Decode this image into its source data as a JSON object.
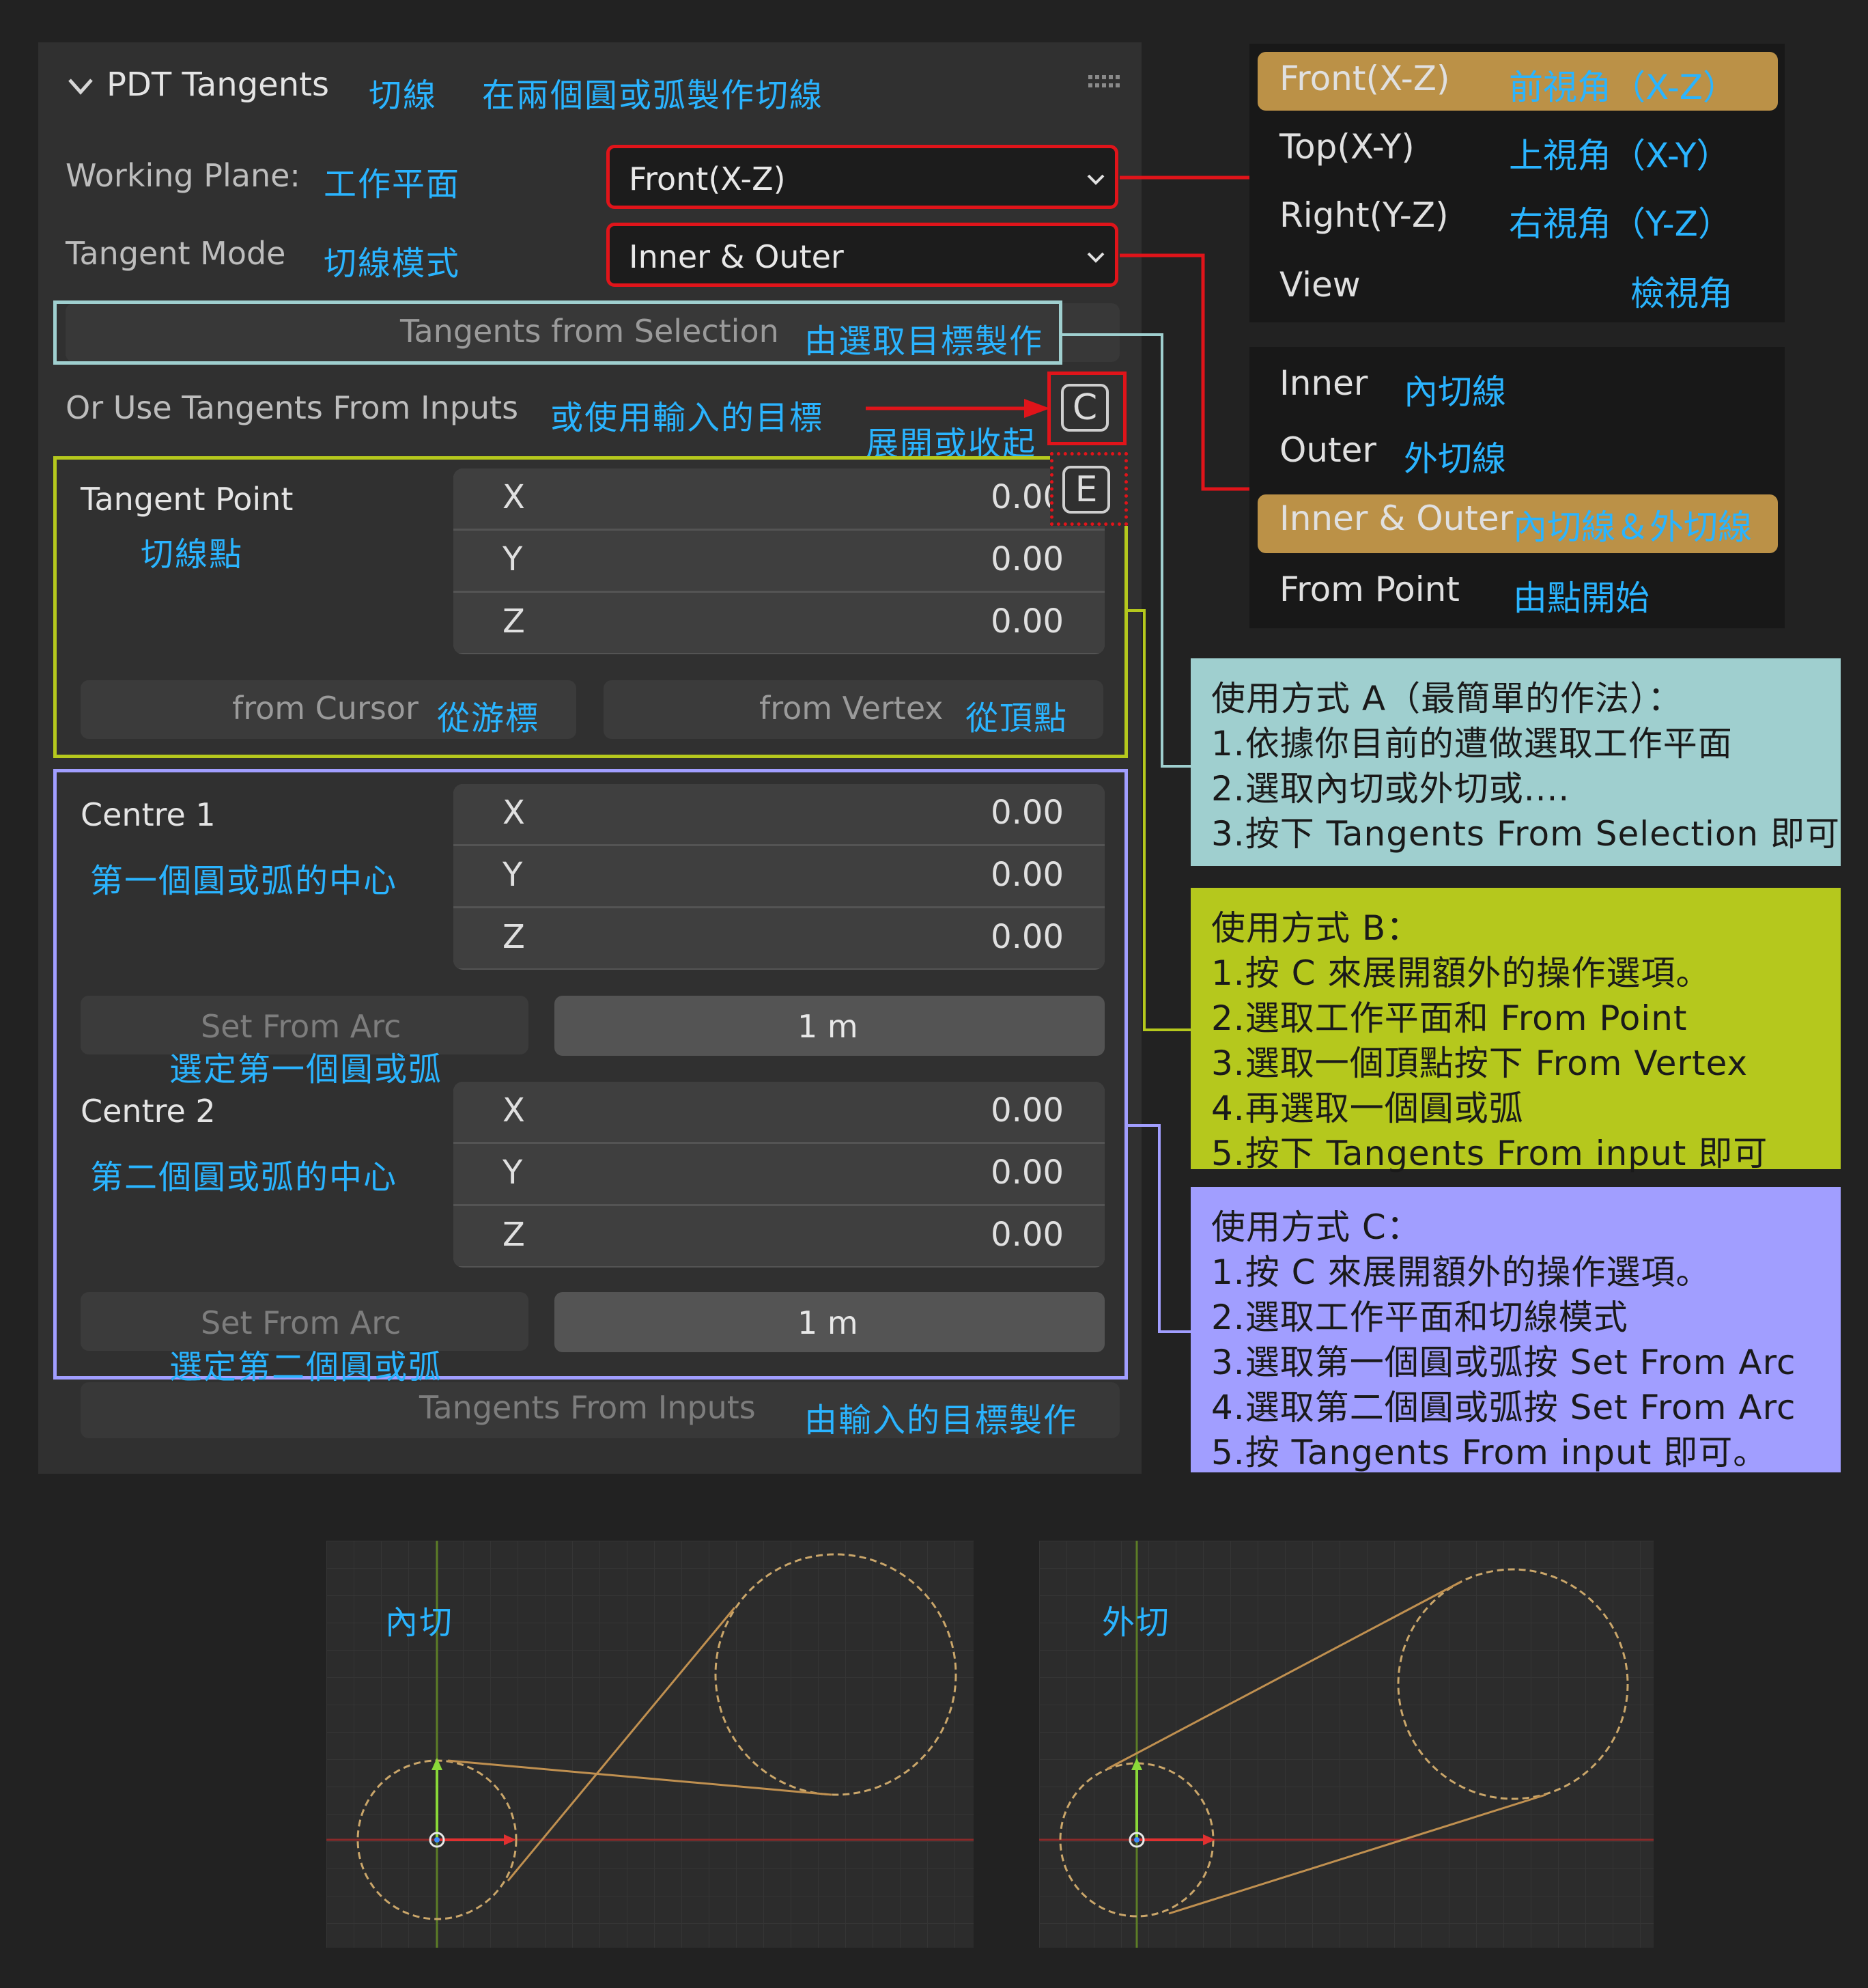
{
  "panel": {
    "title": "PDT Tangents",
    "title_cn": "切線",
    "title_desc_cn": "在兩個圓或弧製作切線",
    "working_plane_label": "Working Plane:",
    "working_plane_cn": "工作平面",
    "working_plane_value": "Front(X-Z)",
    "tangent_mode_label": "Tangent Mode",
    "tangent_mode_cn": "切線模式",
    "tangent_mode_value": "Inner & Outer",
    "from_selection_btn": "Tangents from Selection",
    "from_selection_cn": "由選取目標製作",
    "inputs_label": "Or Use Tangents From Inputs",
    "inputs_cn": "或使用輸入的目標",
    "expand_cn": "展開或收起",
    "c_icon": "C",
    "e_icon": "E",
    "tangent_point": {
      "label": "Tangent Point",
      "cn": "切線點",
      "x_label": "X",
      "x": "0.00",
      "y_label": "Y",
      "y": "0.00",
      "z_label": "Z",
      "z": "0.00",
      "from_cursor": "from Cursor",
      "from_cursor_cn": "從游標",
      "from_vertex": "from Vertex",
      "from_vertex_cn": "從頂點"
    },
    "centre1": {
      "label": "Centre 1",
      "cn": "第一個圓或弧的中心",
      "x_label": "X",
      "x": "0.00",
      "y_label": "Y",
      "y": "0.00",
      "z_label": "Z",
      "z": "0.00",
      "set_from_arc": "Set From Arc",
      "set_from_arc_cn": "選定第一個圓或弧",
      "radius": "1 m"
    },
    "centre2": {
      "label": "Centre 2",
      "cn": "第二個圓或弧的中心",
      "x_label": "X",
      "x": "0.00",
      "y_label": "Y",
      "y": "0.00",
      "z_label": "Z",
      "z": "0.00",
      "set_from_arc": "Set From Arc",
      "set_from_arc_cn": "選定第二個圓或弧",
      "radius": "1 m"
    },
    "from_inputs_btn": "Tangents From Inputs",
    "from_inputs_cn": "由輸入的目標製作"
  },
  "plane_menu": {
    "items": [
      {
        "label": "Front(X-Z)",
        "cn": "前視角（X-Z）"
      },
      {
        "label": "Top(X-Y)",
        "cn": "上視角（X-Y）"
      },
      {
        "label": "Right(Y-Z)",
        "cn": "右視角（Y-Z）"
      },
      {
        "label": "View",
        "cn": "檢視角"
      }
    ]
  },
  "mode_menu": {
    "items": [
      {
        "label": "Inner",
        "cn": "內切線"
      },
      {
        "label": "Outer",
        "cn": "外切線"
      },
      {
        "label": "Inner & Outer",
        "cn": "內切線＆外切線"
      },
      {
        "label": "From Point",
        "cn": "由點開始"
      }
    ]
  },
  "notes": {
    "a": [
      "使用方式 A（最簡單的作法）：",
      "1.依據你目前的遭做選取工作平面",
      "2.選取內切或外切或....",
      "3.按下 Tangents From Selection 即可"
    ],
    "b": [
      "使用方式 B：",
      "1.按 C 來展開額外的操作選項。",
      "2.選取工作平面和 From Point",
      "3.選取一個頂點按下 From Vertex",
      "4.再選取一個圓或弧",
      "5.按下 Tangents From input 即可"
    ],
    "c": [
      "使用方式 C：",
      "1.按 C 來展開額外的操作選項。",
      "2.選取工作平面和切線模式",
      "3.選取第一個圓或弧按 Set From Arc",
      "4.選取第二個圓或弧按 Set From Arc",
      "5.按 Tangents From input 即可。"
    ]
  },
  "viewports": {
    "inner_label": "內切",
    "outer_label": "外切"
  },
  "colors": {
    "cn_text": "#2ab4ff",
    "red_outline": "#e0141a",
    "cyan_outline": "#9fcfcf",
    "green_outline": "#b5c81d",
    "purple_outline": "#a19eff",
    "note_a": "#9fcfcf",
    "note_b": "#b5c81d",
    "note_c": "#a19eff",
    "menu_highlight": "#bb9147"
  }
}
